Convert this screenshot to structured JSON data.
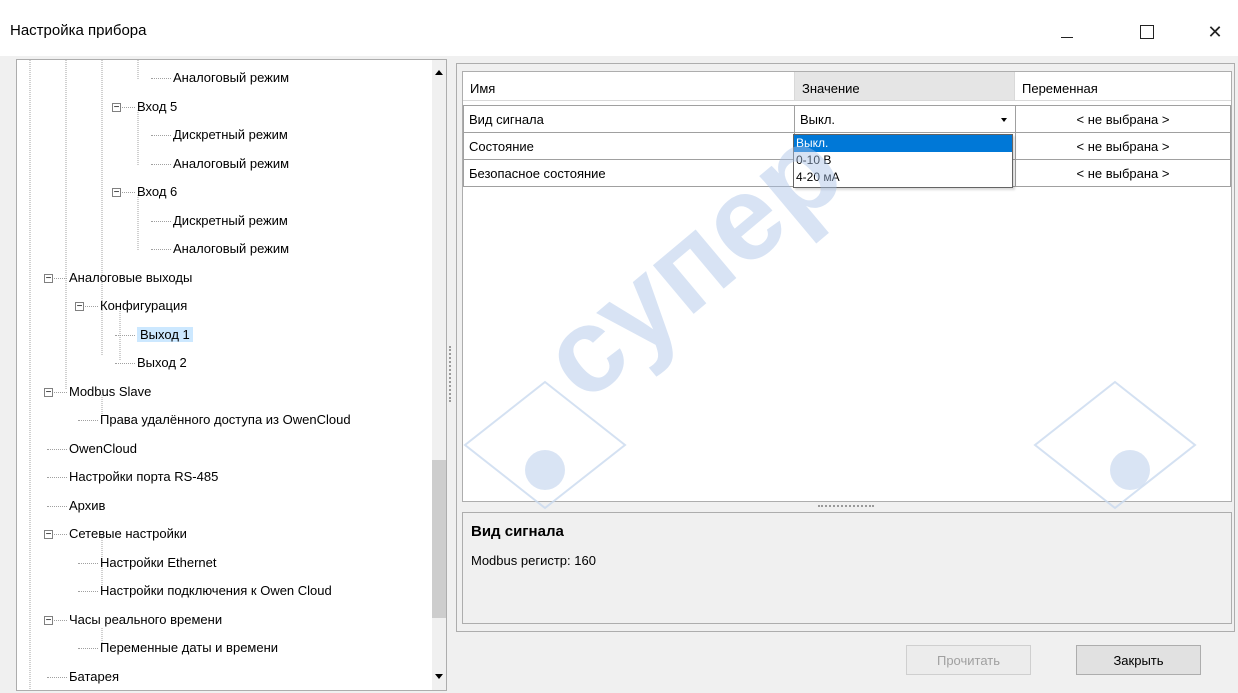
{
  "window": {
    "title": "Настройка прибора",
    "controls": {
      "minimize": "–",
      "maximize": "□",
      "close": "✕"
    }
  },
  "tree": {
    "items": [
      {
        "label": "Аналоговый режим",
        "level": 4,
        "expander": ""
      },
      {
        "label": "Вход 5",
        "level": 3,
        "expander": "-"
      },
      {
        "label": "Дискретный режим",
        "level": 4,
        "expander": ""
      },
      {
        "label": "Аналоговый режим",
        "level": 4,
        "expander": ""
      },
      {
        "label": "Вход 6",
        "level": 3,
        "expander": "-"
      },
      {
        "label": "Дискретный режим",
        "level": 4,
        "expander": ""
      },
      {
        "label": "Аналоговый режим",
        "level": 4,
        "expander": ""
      },
      {
        "label": "Аналоговые выходы",
        "level": 1,
        "expander": "-"
      },
      {
        "label": "Конфигурация",
        "level": 2,
        "expander": "-"
      },
      {
        "label": "Выход 1",
        "level": 3,
        "expander": "",
        "selected": true
      },
      {
        "label": "Выход 2",
        "level": 3,
        "expander": ""
      },
      {
        "label": "Modbus Slave",
        "level": 1,
        "expander": "-"
      },
      {
        "label": "Права удалённого доступа из OwenCloud",
        "level": 2,
        "expander": ""
      },
      {
        "label": "OwenCloud",
        "level": 1,
        "expander": ""
      },
      {
        "label": "Настройки порта RS-485",
        "level": 1,
        "expander": ""
      },
      {
        "label": "Архив",
        "level": 1,
        "expander": ""
      },
      {
        "label": "Сетевые настройки",
        "level": 1,
        "expander": "-"
      },
      {
        "label": "Настройки Ethernet",
        "level": 2,
        "expander": ""
      },
      {
        "label": "Настройки подключения к Owen Cloud",
        "level": 2,
        "expander": ""
      },
      {
        "label": "Часы реального времени",
        "level": 1,
        "expander": "-"
      },
      {
        "label": "Переменные даты и времени",
        "level": 2,
        "expander": ""
      },
      {
        "label": "Батарея",
        "level": 1,
        "expander": ""
      }
    ]
  },
  "grid": {
    "columns": [
      "Имя",
      "Значение",
      "Переменная"
    ],
    "rows": [
      {
        "name": "Вид сигнала",
        "value": "Выкл.",
        "variable": "< не выбрана >"
      },
      {
        "name": "Состояние",
        "value": "",
        "variable": "< не выбрана >"
      },
      {
        "name": "Безопасное состояние",
        "value": "",
        "variable": "< не выбрана >"
      }
    ],
    "dropdown_options": [
      "Выкл.",
      "0-10 В",
      "4-20 мА"
    ],
    "highlighted_option": 0
  },
  "description": {
    "title": "Вид сигнала",
    "text": "Modbus регистр: 160"
  },
  "buttons": {
    "read": "Прочитать",
    "close": "Закрыть"
  },
  "watermark": {
    "text": "супер",
    "color": "#b9d0ef"
  }
}
